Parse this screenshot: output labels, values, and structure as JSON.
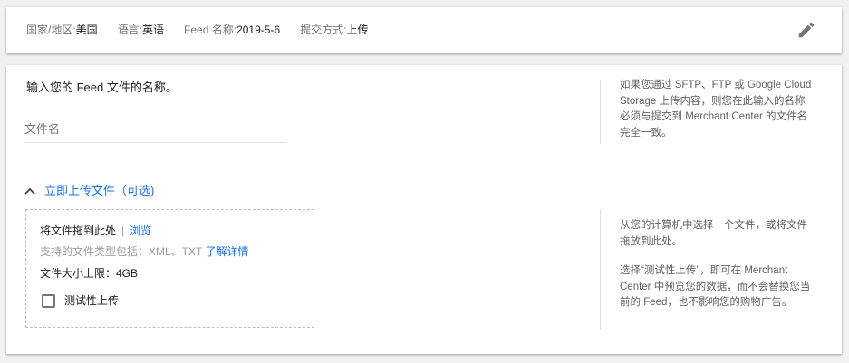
{
  "summary": {
    "country_label": "国家/地区:",
    "country_value": "美国",
    "language_label": "语言:",
    "language_value": "英语",
    "feed_name_label": "Feed 名称:",
    "feed_name_value": "2019-5-6",
    "submit_method_label": "提交方式:",
    "submit_method_value": "上传",
    "edit_icon": "pencil-icon"
  },
  "form": {
    "instruction": "输入您的 Feed 文件的名称。",
    "filename_placeholder": "文件名",
    "filename_help": "如果您通过 SFTP、FTP 或 Google Cloud Storage 上传内容，则您在此输入的名称必须与提交到 Merchant Center 的文件名完全一致。"
  },
  "upload": {
    "toggle_label": "立即上传文件（可选)",
    "toggle_icon": "chevron-up-icon",
    "drag_text": "将文件拖到此处",
    "separator": "|",
    "browse_label": "浏览",
    "supported_types": "支持的文件类型包括：XML、TXT",
    "learn_more": "了解详情",
    "size_limit": "文件大小上限：4GB",
    "test_upload_label": "测试性上传",
    "test_upload_checked": false,
    "help_choose": "从您的计算机中选择一个文件，或将文件拖放到此处。",
    "help_test": "选择“测试性上传”，即可在 Merchant Center 中预览您的数据，而不会替换您当前的 Feed，也不影响您的购物广告。"
  },
  "colors": {
    "accent": "#1a73e8",
    "text_primary": "#212121",
    "text_secondary": "#757575",
    "background": "#f1f1f1"
  }
}
